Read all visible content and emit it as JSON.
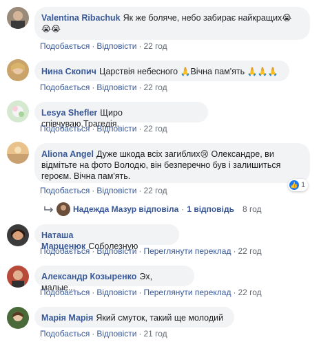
{
  "colors": {
    "link": "#385898",
    "bubble": "#f2f3f5",
    "meta": "#606770",
    "like": "#1877f2"
  },
  "actions": {
    "like": "Подобається",
    "reply": "Відповісти",
    "translate": "Переглянути переклад",
    "sep": "·"
  },
  "comments": [
    {
      "author": "Valentina Ribachuk",
      "text": "Як же боляче, небо забирає найкращих",
      "text2": "",
      "emojis": [
        "😭",
        "😭",
        "😭"
      ],
      "time": "22 год"
    },
    {
      "author": "Нина Скопич",
      "text": "Царствія небесного",
      "text_after": "Вічна пам'ять",
      "emojis": [
        "🙏",
        "🙏",
        "🙏",
        "🙏"
      ],
      "time": "22 год"
    },
    {
      "author": "Lesya Shefler",
      "text": "Щиро співчуваю.Трагедія.",
      "time": "22 год"
    },
    {
      "author": "Aliona Angel",
      "line1": "Дуже шкода всіх загиблих",
      "line1_after": "Олександре, ви",
      "line2": "відмітьте на фото Володю, він безперечно був і залишиться",
      "line3": "героєм. Вічна пам'ять.",
      "emoji": "😢",
      "time": "22 год",
      "reaction": {
        "icon": "like-icon",
        "count": "1"
      }
    },
    {
      "author": "Наташа Марценюк",
      "text": "Соболезную",
      "time": "22 год"
    },
    {
      "author": "Александр Козыренко",
      "text": "Эх, малые...",
      "time": "22 год"
    },
    {
      "author": "Марія Марія",
      "text": "Який смуток, такий ще молодий .",
      "time": "21 год"
    }
  ],
  "reply": {
    "text": "Надежда Мазур відповіла",
    "sep": "·",
    "count": "1 відповідь",
    "time": "8 год"
  }
}
